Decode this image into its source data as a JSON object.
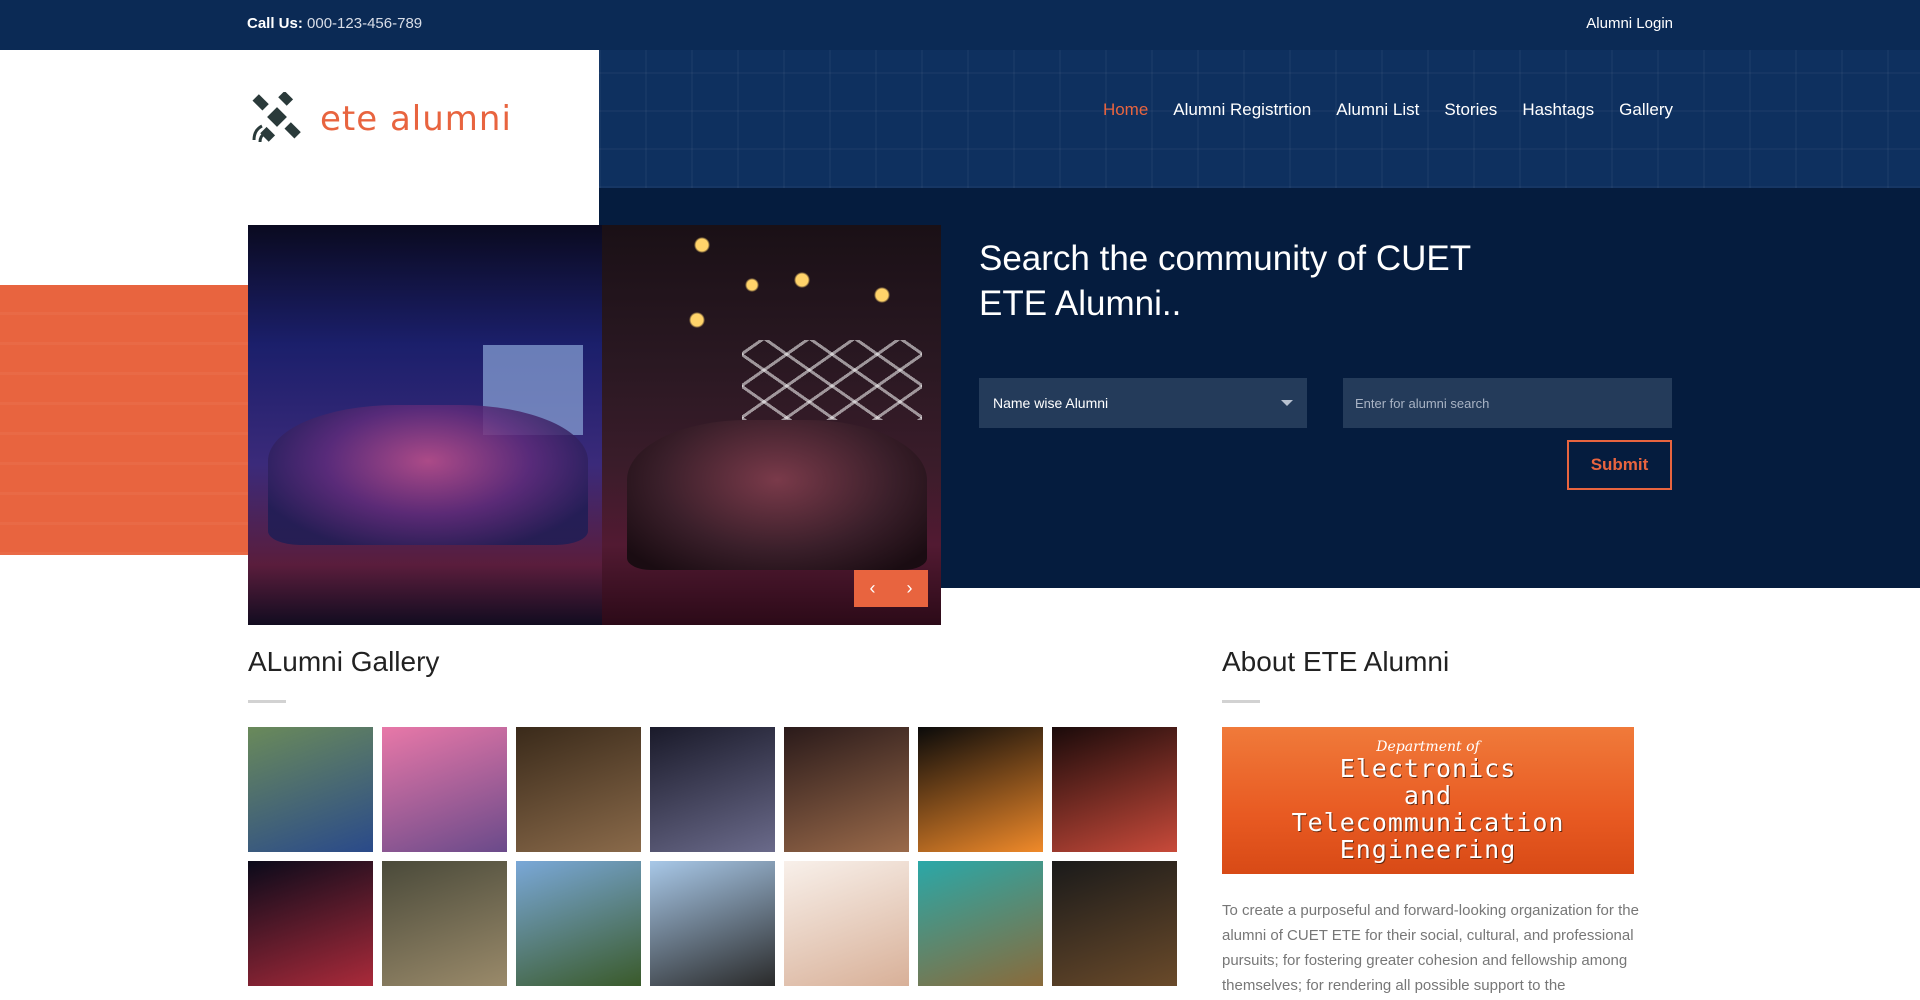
{
  "topbar": {
    "call_label": "Call Us:",
    "call_number": "000-123-456-789",
    "login": "Alumni Login"
  },
  "logo": {
    "text": "ete alumni"
  },
  "nav": {
    "items": [
      "Home",
      "Alumni Registrtion",
      "Alumni List",
      "Stories",
      "Hashtags",
      "Gallery"
    ],
    "active": "Home"
  },
  "hero": {
    "title_line1": "Search the community of CUET",
    "title_line2": "ETE Alumni..",
    "select_value": "Name wise Alumni",
    "search_placeholder": "Enter for alumni search",
    "submit": "Submit",
    "prev_arrow": "‹",
    "next_arrow": "›"
  },
  "gallery": {
    "title": "ALumni Gallery",
    "thumbs": [
      {
        "name": "gallery-thumb-sports-team",
        "colors": [
          "#6a8a5a",
          "#2a4a8a"
        ]
      },
      {
        "name": "gallery-thumb-holi-colors",
        "colors": [
          "#e878a8",
          "#6a4a8a"
        ]
      },
      {
        "name": "gallery-thumb-group-lights",
        "colors": [
          "#3a2a1a",
          "#8a6a4a"
        ]
      },
      {
        "name": "gallery-thumb-dance",
        "colors": [
          "#1a1a2a",
          "#6a6a8a"
        ]
      },
      {
        "name": "gallery-thumb-night-group",
        "colors": [
          "#2a1a1a",
          "#9a6a4a"
        ]
      },
      {
        "name": "gallery-thumb-fire-breather",
        "colors": [
          "#0a0a0a",
          "#f08a2a"
        ]
      },
      {
        "name": "gallery-thumb-candle-circle",
        "colors": [
          "#1a0a0a",
          "#c84a3a"
        ]
      },
      {
        "name": "gallery-thumb-stage-show",
        "colors": [
          "#0a0a1a",
          "#aa2a3a"
        ]
      },
      {
        "name": "gallery-thumb-field-group",
        "colors": [
          "#4a4a3a",
          "#9a8a6a"
        ]
      },
      {
        "name": "gallery-thumb-graduation-caps",
        "colors": [
          "#7aa8d8",
          "#3a5a2a"
        ]
      },
      {
        "name": "gallery-thumb-cuet-50",
        "colors": [
          "#a8c8e8",
          "#2a2a2a"
        ]
      },
      {
        "name": "gallery-thumb-anime-art",
        "colors": [
          "#f8f0ea",
          "#d8b098"
        ]
      },
      {
        "name": "gallery-thumb-aerial-island",
        "colors": [
          "#2aa8a8",
          "#8a6a3a"
        ]
      },
      {
        "name": "gallery-thumb-laptop-code",
        "colors": [
          "#1a1a1a",
          "#6a4a2a"
        ]
      }
    ]
  },
  "about": {
    "title": "About ETE Alumni",
    "image_dept": "Department of",
    "image_line1": "Electronics",
    "image_line2": "and",
    "image_line3": "Telecommunication",
    "image_line4": "Engineering",
    "text": "To create a purposeful and forward-looking organization for the alumni of CUET ETE for their social, cultural, and professional pursuits; for fostering greater cohesion and fellowship among themselves; for rendering all possible support to the"
  },
  "colors": {
    "accent": "#e8643f",
    "navy": "#0b2a55",
    "dark_navy": "#051c3e"
  }
}
